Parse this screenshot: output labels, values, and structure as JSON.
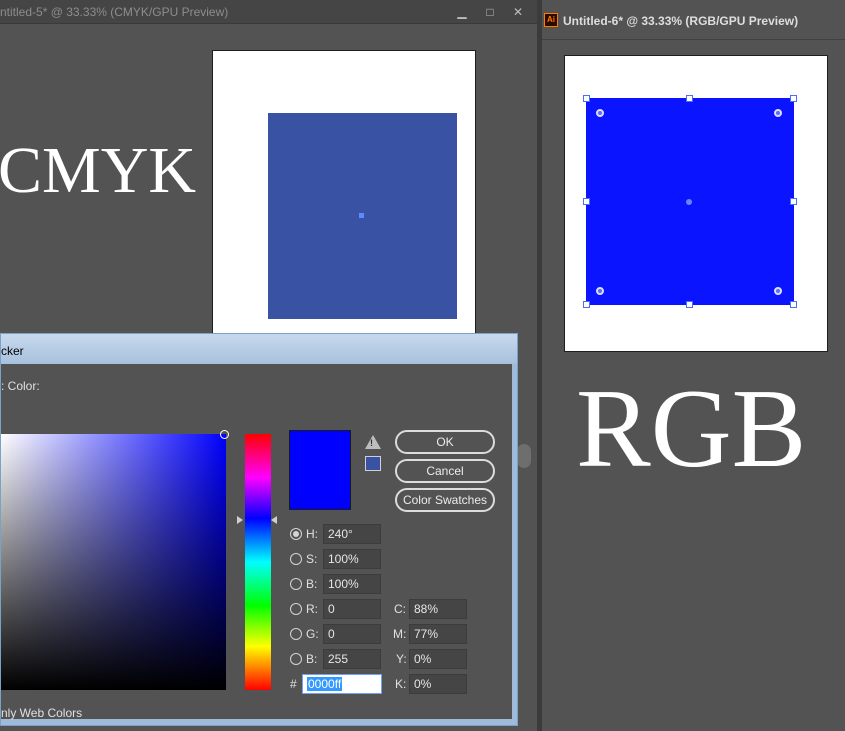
{
  "left_document": {
    "title": "ntitled-5* @ 33.33% (CMYK/GPU Preview)",
    "minimize": "▁",
    "restore": "□",
    "close": "✕",
    "label": "CMYK",
    "square_color": "#3952a4"
  },
  "right_document": {
    "title": "Untitled-6* @ 33.33% (RGB/GPU Preview)",
    "app_icon": "Ai",
    "label": "RGB",
    "square_color": "#0a14ff"
  },
  "color_picker": {
    "title": "cker",
    "select_label": ": Color:",
    "new_color": "#0000ff",
    "out_of_gamut_color": "#3952a4",
    "warning_icon": "!",
    "buttons": {
      "ok": "OK",
      "cancel": "Cancel",
      "swatches": "Color Swatches"
    },
    "hsb": {
      "h_label": "H:",
      "h_value": "240°",
      "s_label": "S:",
      "s_value": "100%",
      "b_label": "B:",
      "b_value": "100%"
    },
    "rgb": {
      "r_label": "R:",
      "r_value": "0",
      "g_label": "G:",
      "g_value": "0",
      "b_label": "B:",
      "b_value": "255"
    },
    "cmyk": {
      "c_label": "C:",
      "c_value": "88%",
      "m_label": "M:",
      "m_value": "77%",
      "y_label": "Y:",
      "y_value": "0%",
      "k_label": "K:",
      "k_value": "0%"
    },
    "hex_label": "#",
    "hex_value": "0000ff",
    "web_colors_label": "nly Web Colors",
    "selected_mode": "H"
  }
}
